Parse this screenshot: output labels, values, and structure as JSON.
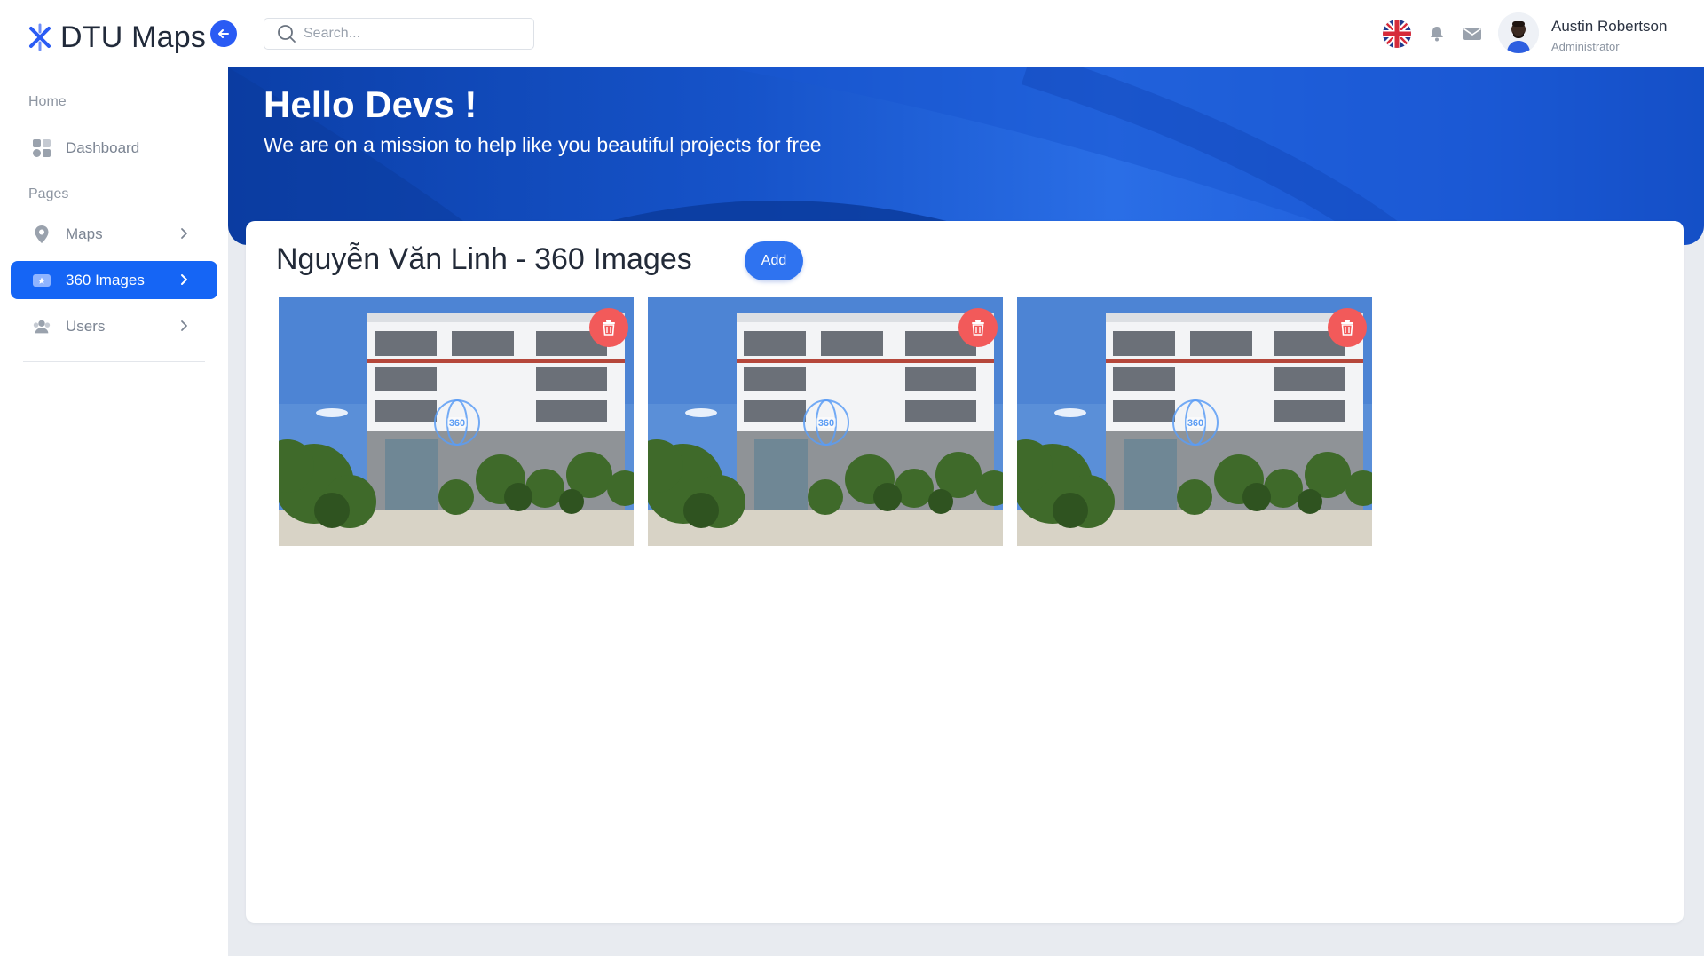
{
  "brand": {
    "name": "DTU Maps"
  },
  "search": {
    "placeholder": "Search..."
  },
  "user": {
    "name": "Austin Robertson",
    "role": "Administrator"
  },
  "sidebar": {
    "sections": [
      {
        "label": "Home"
      },
      {
        "label": "Pages"
      }
    ],
    "items": [
      {
        "label": "Dashboard",
        "icon": "dashboard-icon"
      },
      {
        "label": "Maps",
        "icon": "map-pin-icon"
      },
      {
        "label": "360 Images",
        "icon": "image-icon",
        "active": true
      },
      {
        "label": "Users",
        "icon": "users-icon"
      }
    ]
  },
  "banner": {
    "title": "Hello Devs !",
    "subtitle": "We are on a mission to help like you beautiful projects for free"
  },
  "main": {
    "title": "Nguyễn Văn Linh - 360 Images",
    "add_label": "Add",
    "images": [
      {
        "badge": "360"
      },
      {
        "badge": "360"
      },
      {
        "badge": "360"
      }
    ]
  },
  "colors": {
    "accent": "#1565f5",
    "banner": "#1653c9",
    "delete": "#f25a5a",
    "add_button": "#2f73f0"
  }
}
